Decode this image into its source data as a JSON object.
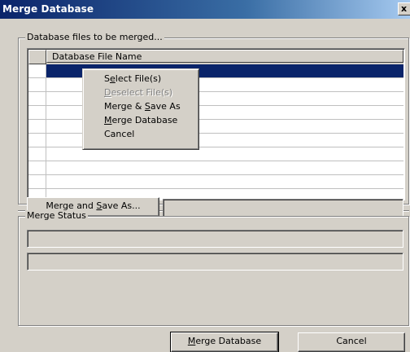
{
  "window": {
    "title": "Merge Database",
    "close_glyph": "x"
  },
  "files_group": {
    "legend": "Database files to be merged...",
    "column_header": "Database File Name",
    "rows": [
      "",
      "",
      "",
      "",
      "",
      "",
      "",
      "",
      "",
      ""
    ],
    "selected_row_index": 0
  },
  "context_menu": {
    "items": [
      {
        "pre": "S",
        "accel": "e",
        "post": "lect File(s)",
        "enabled": true
      },
      {
        "pre": "",
        "accel": "D",
        "post": "eselect File(s)",
        "enabled": false
      },
      {
        "pre": "Merge & ",
        "accel": "S",
        "post": "ave As",
        "enabled": true
      },
      {
        "pre": "",
        "accel": "M",
        "post": "erge Database",
        "enabled": true
      },
      {
        "pre": "Cancel",
        "accel": "",
        "post": "",
        "enabled": true
      }
    ]
  },
  "save_as": {
    "button": {
      "pre": "Merge and ",
      "accel": "S",
      "post": "ave As..."
    },
    "path_value": ""
  },
  "status_group": {
    "legend": "Merge Status",
    "status_text": "",
    "progress_text": ""
  },
  "footer": {
    "merge_button": {
      "pre": "",
      "accel": "M",
      "post": "erge Database"
    },
    "cancel_button": "Cancel"
  }
}
